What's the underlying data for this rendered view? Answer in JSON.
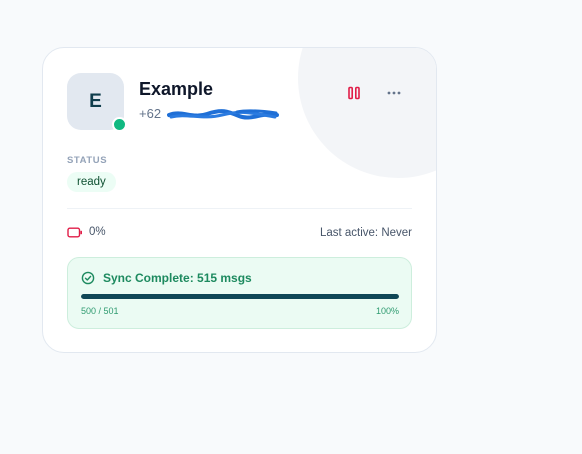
{
  "card": {
    "avatar_letter": "E",
    "name": "Example",
    "phone_prefix": "+62",
    "online_color": "#10b981",
    "status_label": "STATUS",
    "status_value": "ready",
    "battery_text": "0%",
    "last_active": "Last active: Never"
  },
  "actions": {
    "pause_icon": "pause-icon",
    "more_icon": "more-horizontal-icon",
    "pause_color": "#e11d48"
  },
  "sync": {
    "title": "Sync Complete: 515 msgs",
    "count": "500 / 501",
    "percent_label": "100%",
    "progress": 1.0,
    "icon": "check-circle-icon",
    "bar_color": "#0f4756"
  }
}
